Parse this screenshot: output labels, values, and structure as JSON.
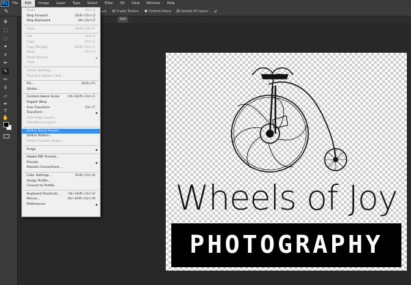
{
  "app": {
    "logo": "Ps"
  },
  "menubar": [
    "File",
    "Edit",
    "Image",
    "Layer",
    "Type",
    "Select",
    "Filter",
    "3D",
    "View",
    "Window",
    "Help"
  ],
  "options_bar": {
    "partial_label": "atch",
    "create_texture": "Create Texture",
    "content_aware": "Content-Aware",
    "sample_all_layers": "Sample All Layers"
  },
  "doc_tab": {
    "label": "B/8)"
  },
  "edit_menu": {
    "groups": [
      [
        {
          "label": "Undo",
          "shortcut": "Ctrl+Z",
          "disabled": true
        },
        {
          "label": "Step Forward",
          "shortcut": "Shift+Ctrl+Z"
        },
        {
          "label": "Step Backward",
          "shortcut": "Alt+Ctrl+Z"
        }
      ],
      [
        {
          "label": "Fade...",
          "shortcut": "Shift+Ctrl+F",
          "disabled": true
        }
      ],
      [
        {
          "label": "Cut",
          "shortcut": "Ctrl+X",
          "disabled": true
        },
        {
          "label": "Copy",
          "shortcut": "Ctrl+C",
          "disabled": true
        },
        {
          "label": "Copy Merged",
          "shortcut": "Shift+Ctrl+C",
          "disabled": true
        },
        {
          "label": "Paste",
          "shortcut": "Ctrl+V",
          "disabled": true
        },
        {
          "label": "Paste Special",
          "submenu": true,
          "disabled": true
        },
        {
          "label": "Clear",
          "disabled": true
        }
      ],
      [
        {
          "label": "Check Spelling...",
          "disabled": true
        },
        {
          "label": "Find and Replace Text...",
          "disabled": true
        }
      ],
      [
        {
          "label": "Fill...",
          "shortcut": "Shift+F5"
        },
        {
          "label": "Stroke..."
        }
      ],
      [
        {
          "label": "Content-Aware Scale",
          "shortcut": "Alt+Shift+Ctrl+C"
        },
        {
          "label": "Puppet Warp"
        },
        {
          "label": "Free Transform",
          "shortcut": "Ctrl+T"
        },
        {
          "label": "Transform",
          "submenu": true
        },
        {
          "label": "Auto-Align Layers...",
          "disabled": true
        },
        {
          "label": "Auto-Blend Layers...",
          "disabled": true
        }
      ],
      [
        {
          "label": "Define Brush Preset...",
          "highlighted": true
        },
        {
          "label": "Define Pattern..."
        },
        {
          "label": "Define Custom Shape...",
          "disabled": true
        }
      ],
      [
        {
          "label": "Purge",
          "submenu": true
        }
      ],
      [
        {
          "label": "Adobe PDF Presets..."
        },
        {
          "label": "Presets",
          "submenu": true
        },
        {
          "label": "Remote Connections..."
        }
      ],
      [
        {
          "label": "Color Settings...",
          "shortcut": "Shift+Ctrl+K"
        },
        {
          "label": "Assign Profile..."
        },
        {
          "label": "Convert to Profile..."
        }
      ],
      [
        {
          "label": "Keyboard Shortcuts...",
          "shortcut": "Alt+Shift+Ctrl+K"
        },
        {
          "label": "Menus...",
          "shortcut": "Alt+Shift+Ctrl+M"
        },
        {
          "label": "Preferences",
          "submenu": true
        }
      ]
    ]
  },
  "canvas": {
    "logo_title": "Wheels of Joy",
    "logo_subtitle": "PHOTOGRAPHY"
  },
  "colors": {
    "highlight": "#3c8ee6",
    "foreground": "#000000",
    "background": "#ffffff"
  }
}
